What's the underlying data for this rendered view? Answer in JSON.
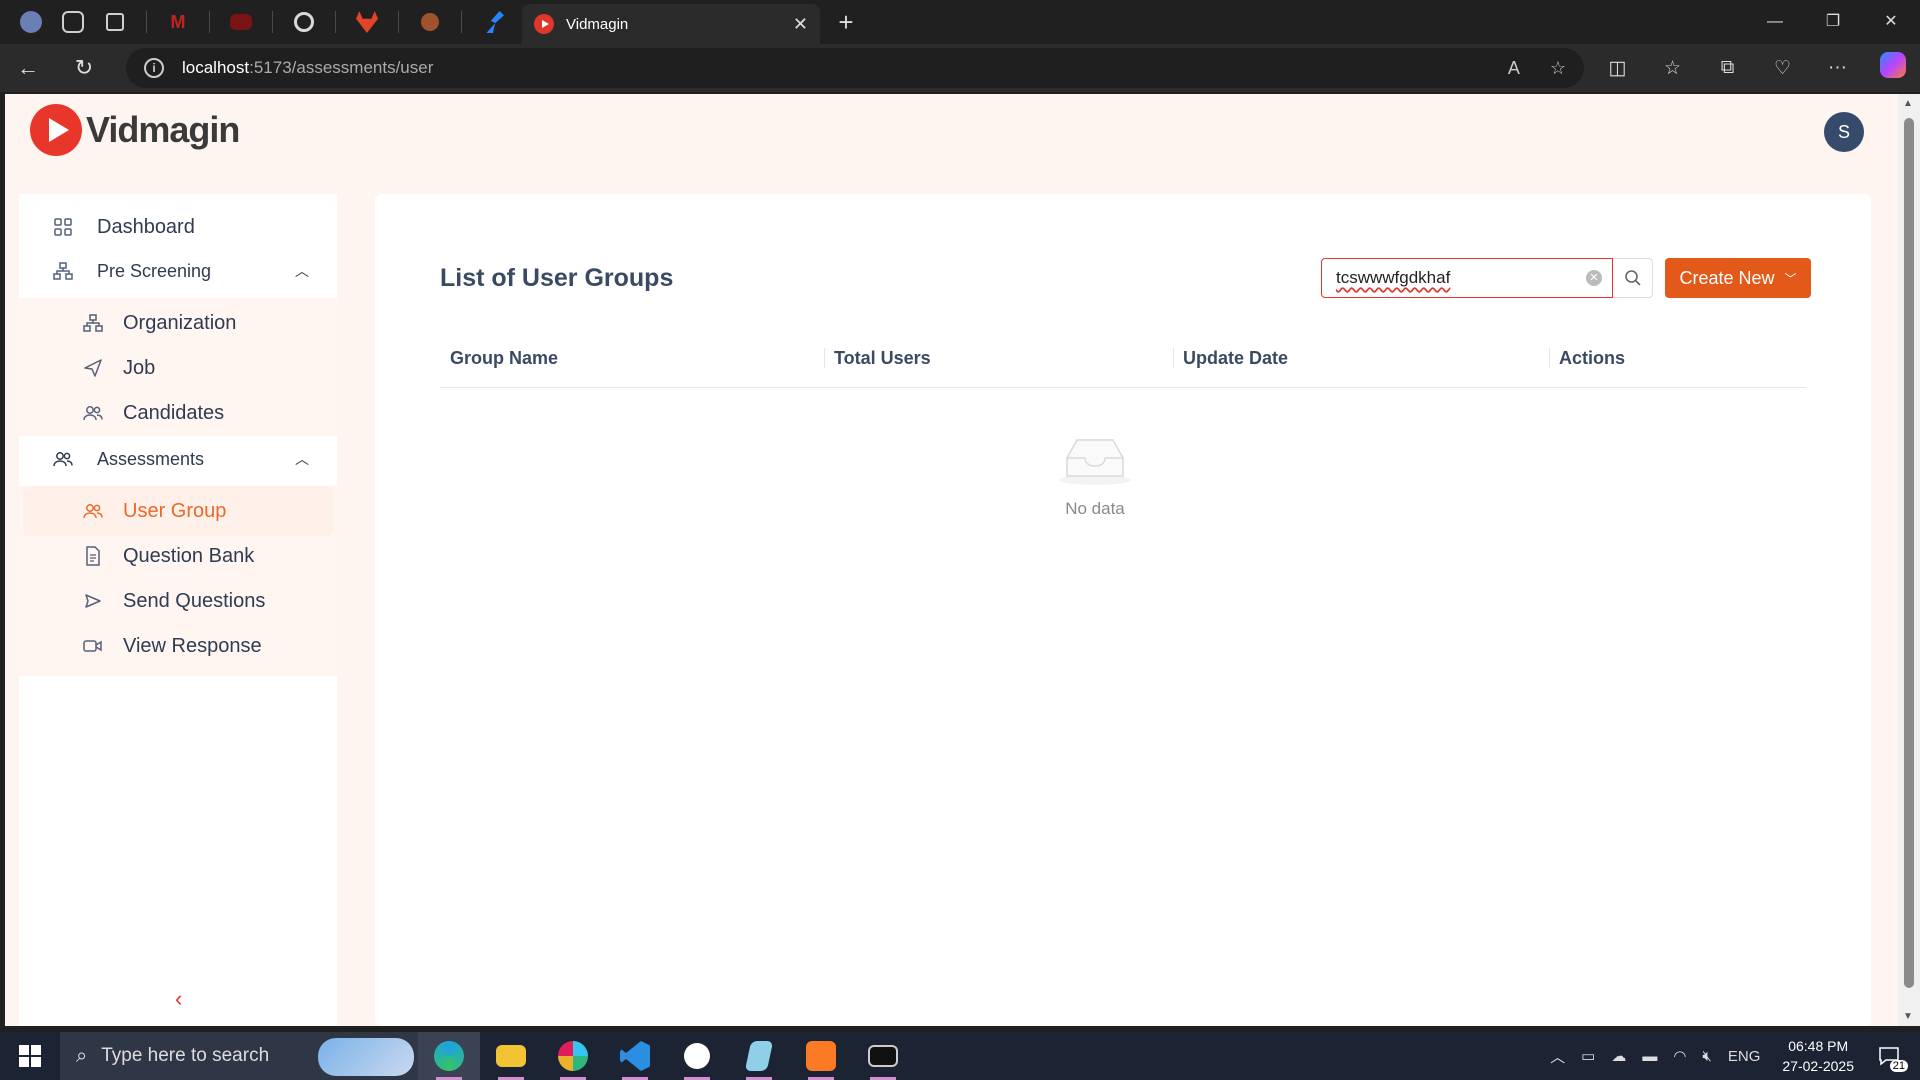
{
  "browser": {
    "pinned_tabs": [
      {
        "name": "profile-icon",
        "color": "#6a7fb5"
      },
      {
        "name": "workspaces-icon",
        "color": "#cfcfcf"
      },
      {
        "name": "tab-actions-icon",
        "color": "#cfcfcf"
      },
      {
        "name": "gmail-icon",
        "color": "#c5221f"
      },
      {
        "name": "youtube-icon",
        "color": "#7a1414"
      },
      {
        "name": "chatgpt-icon",
        "color": "#d9d9d9"
      },
      {
        "name": "gitlab-icon",
        "color": "#e24329"
      },
      {
        "name": "postman-icon",
        "color": "#a0522d"
      },
      {
        "name": "jira-icon",
        "color": "#2684ff"
      }
    ],
    "active_tab_title": "Vidmagin",
    "url_host": "localhost",
    "url_path": ":5173/assessments/user"
  },
  "app": {
    "logo_text": "Vidmagin",
    "avatar_initial": "S"
  },
  "sidebar": {
    "dashboard": "Dashboard",
    "pre_screening": "Pre Screening",
    "organization": "Organization",
    "job": "Job",
    "candidates": "Candidates",
    "assessments": "Assessments",
    "user_group": "User Group",
    "question_bank": "Question Bank",
    "send_questions": "Send Questions",
    "view_response": "View Response"
  },
  "main": {
    "title": "List of User Groups",
    "search_value": "tcswwwfgdkhaf",
    "create_label": "Create New",
    "columns": [
      "Group Name",
      "Total Users",
      "Update Date",
      "Actions"
    ],
    "empty_text": "No data"
  },
  "taskbar": {
    "search_placeholder": "Type here to search",
    "language": "ENG",
    "time": "06:48 PM",
    "date": "27-02-2025",
    "notifications": "21"
  },
  "colors": {
    "accent": "#e2591a",
    "brand_red": "#e0362b",
    "page_bg": "#fff5f0"
  }
}
